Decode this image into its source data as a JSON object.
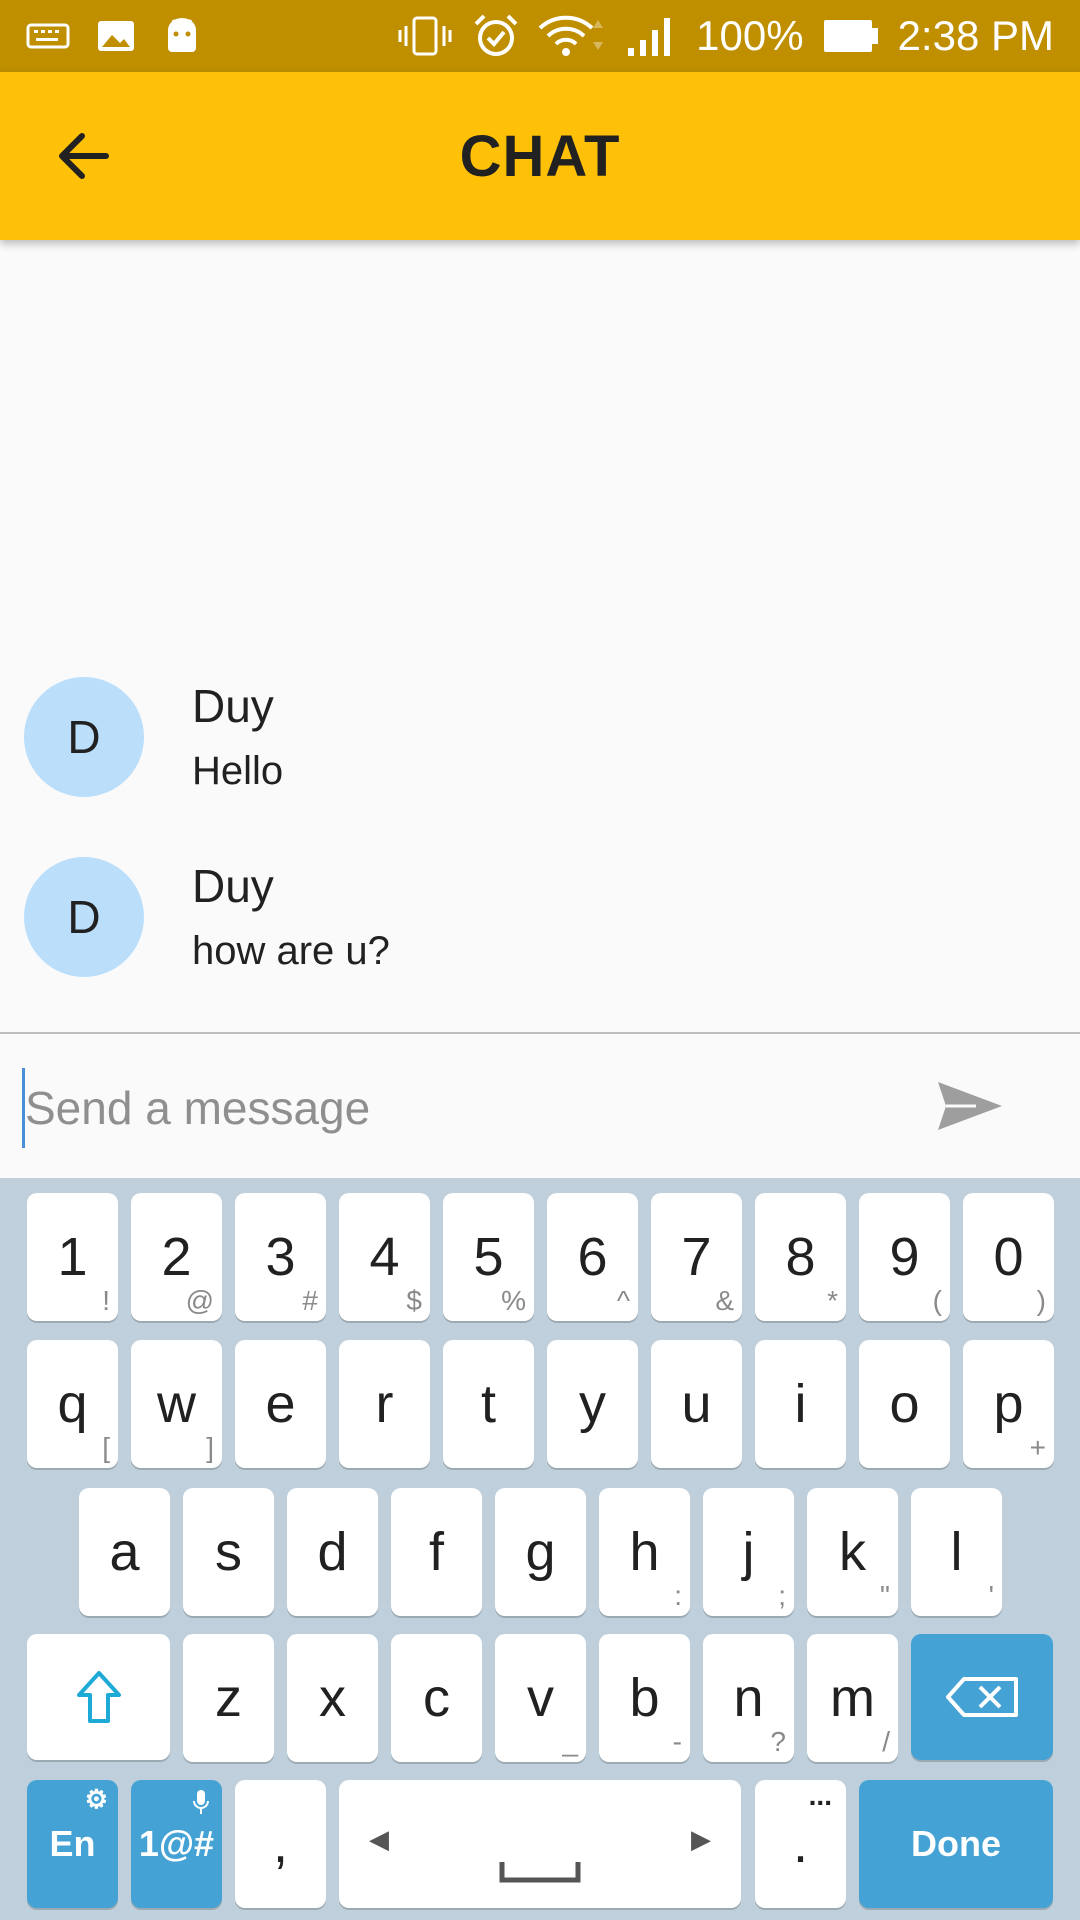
{
  "status_bar": {
    "battery_percent": "100%",
    "time": "2:38 PM",
    "icons_left": [
      "keyboard-icon",
      "image-icon",
      "android-icon"
    ],
    "icons_right": [
      "vibrate-icon",
      "alarm-icon",
      "wifi-icon",
      "signal-icon",
      "battery-icon"
    ]
  },
  "app_bar": {
    "title": "CHAT",
    "back_icon": "arrow-back-icon",
    "background": "#ffc107"
  },
  "messages": [
    {
      "avatar_letter": "D",
      "name": "Duy",
      "text": "Hello"
    },
    {
      "avatar_letter": "D",
      "name": "Duy",
      "text": "how are u?"
    }
  ],
  "composer": {
    "placeholder": "Send a message",
    "send_icon": "send-icon"
  },
  "keyboard": {
    "row1": [
      {
        "label": "1",
        "sub": "!"
      },
      {
        "label": "2",
        "sub": "@"
      },
      {
        "label": "3",
        "sub": "#"
      },
      {
        "label": "4",
        "sub": "$"
      },
      {
        "label": "5",
        "sub": "%"
      },
      {
        "label": "6",
        "sub": "^"
      },
      {
        "label": "7",
        "sub": "&"
      },
      {
        "label": "8",
        "sub": "*"
      },
      {
        "label": "9",
        "sub": "("
      },
      {
        "label": "0",
        "sub": ")"
      }
    ],
    "row2": [
      {
        "label": "q",
        "sub": "["
      },
      {
        "label": "w",
        "sub": "]"
      },
      {
        "label": "e",
        "sub": ""
      },
      {
        "label": "r",
        "sub": ""
      },
      {
        "label": "t",
        "sub": ""
      },
      {
        "label": "y",
        "sub": ""
      },
      {
        "label": "u",
        "sub": ""
      },
      {
        "label": "i",
        "sub": ""
      },
      {
        "label": "o",
        "sub": ""
      },
      {
        "label": "p",
        "sub": "+"
      }
    ],
    "row3": [
      {
        "label": "a",
        "sub": ""
      },
      {
        "label": "s",
        "sub": ""
      },
      {
        "label": "d",
        "sub": ""
      },
      {
        "label": "f",
        "sub": ""
      },
      {
        "label": "g",
        "sub": ""
      },
      {
        "label": "h",
        "sub": ":"
      },
      {
        "label": "j",
        "sub": ";"
      },
      {
        "label": "k",
        "sub": "\""
      },
      {
        "label": "l",
        "sub": "'"
      }
    ],
    "row4": [
      {
        "label": "z",
        "sub": ""
      },
      {
        "label": "x",
        "sub": ""
      },
      {
        "label": "c",
        "sub": ""
      },
      {
        "label": "v",
        "sub": "_"
      },
      {
        "label": "b",
        "sub": "-"
      },
      {
        "label": "n",
        "sub": "?"
      },
      {
        "label": "m",
        "sub": "/"
      }
    ],
    "shift_icon": "shift-icon",
    "backspace_icon": "backspace-icon",
    "lang_label": "En",
    "symbols_label": "1@#",
    "comma_label": ",",
    "period_label": ".",
    "period_sub": "...",
    "done_label": "Done",
    "accent": "#45a2d5"
  }
}
